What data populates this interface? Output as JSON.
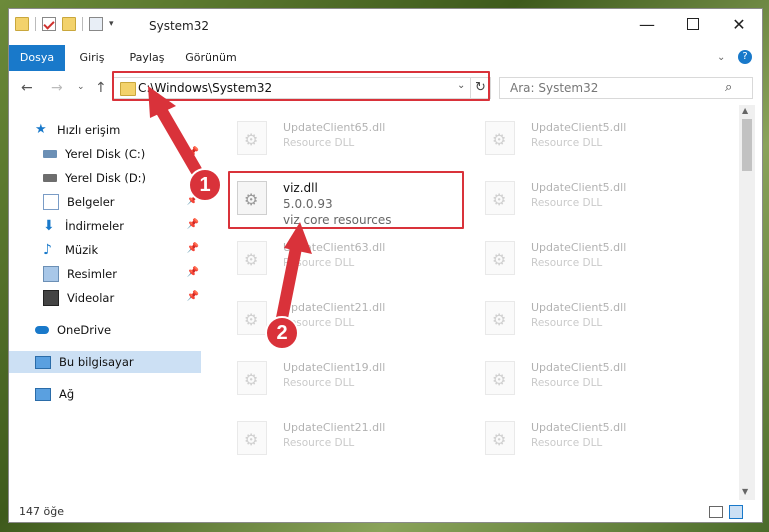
{
  "window": {
    "title": "System32"
  },
  "ribbon": {
    "tabs": [
      "Dosya",
      "Giriş",
      "Paylaş",
      "Görünüm"
    ]
  },
  "address": {
    "path": "C:\\Windows\\System32"
  },
  "search": {
    "placeholder": "Ara: System32"
  },
  "sidebar": {
    "items": [
      "Hızlı erişim",
      "Yerel Disk (C:)",
      "Yerel Disk (D:)",
      "Belgeler",
      "İndirmeler",
      "Müzik",
      "Resimler",
      "Videolar",
      "OneDrive",
      "Bu bilgisayar",
      "Ağ"
    ]
  },
  "files": {
    "left": [
      {
        "name": "UpdateClient65.dll",
        "desc": "Resource DLL"
      },
      {
        "name": "viz.dll",
        "desc": "5.0.0.93",
        "desc2": "viz core resources"
      },
      {
        "name": "UpdateClient63.dll",
        "desc": "Resource DLL"
      },
      {
        "name": "UpdateClient21.dll",
        "desc": "Resource DLL"
      },
      {
        "name": "UpdateClient19.dll",
        "desc": "Resource DLL"
      },
      {
        "name": "UpdateClient21.dll",
        "desc": "Resource DLL"
      }
    ],
    "right": [
      {
        "name": "UpdateClient5.dll",
        "desc": "Resource DLL"
      },
      {
        "name": "UpdateClient5.dll",
        "desc": "Resource DLL"
      },
      {
        "name": "UpdateClient5.dll",
        "desc": "Resource DLL"
      },
      {
        "name": "UpdateClient5.dll",
        "desc": "Resource DLL"
      },
      {
        "name": "UpdateClient5.dll",
        "desc": "Resource DLL"
      },
      {
        "name": "UpdateClient5.dll",
        "desc": "Resource DLL"
      }
    ]
  },
  "status": {
    "count": "147 öğe"
  },
  "annotations": {
    "step1": "1",
    "step2": "2"
  },
  "colors": {
    "accent": "#1979ca",
    "highlight": "#d9323a",
    "selection": "#cce0f4"
  }
}
